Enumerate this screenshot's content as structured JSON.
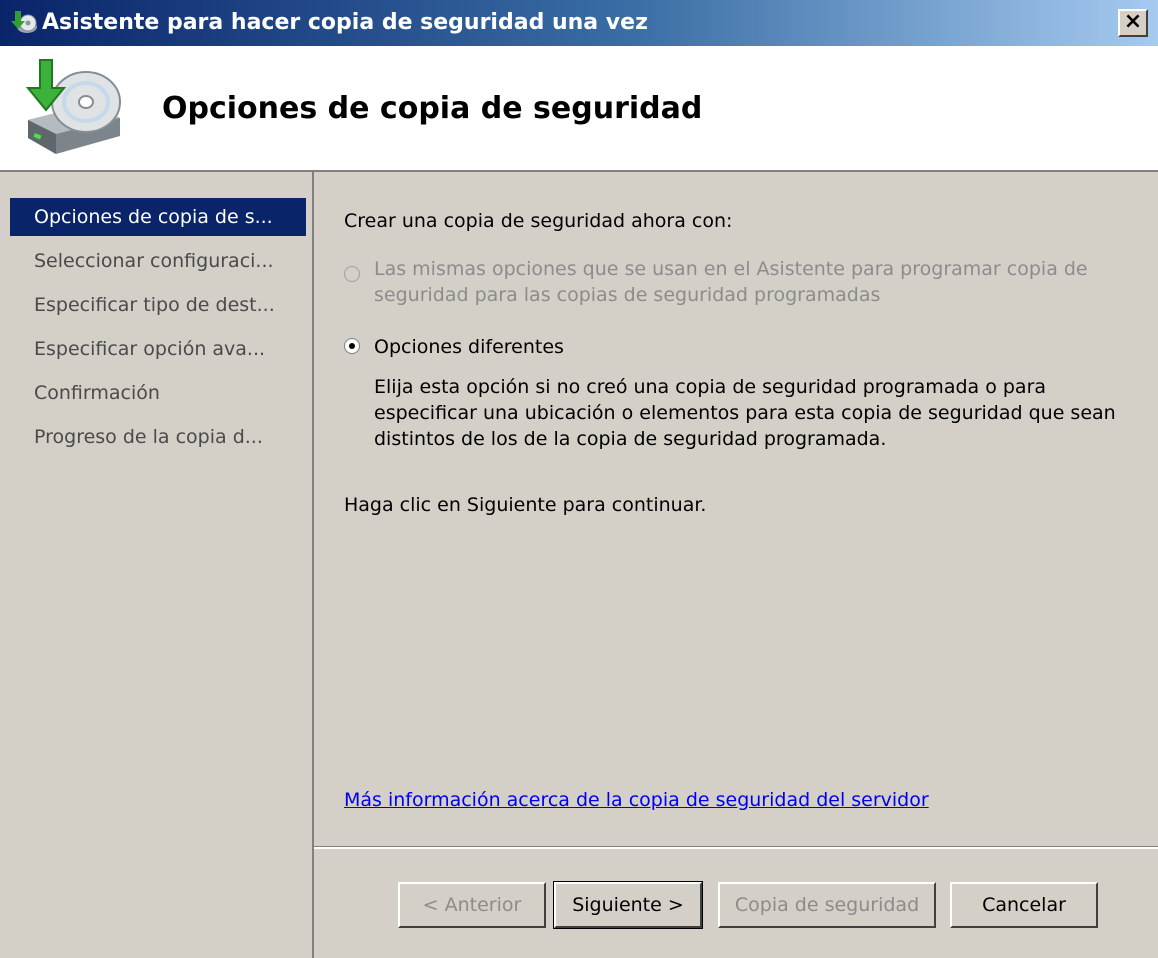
{
  "window": {
    "title": "Asistente para hacer copia de seguridad una vez",
    "close_label": "×"
  },
  "header": {
    "title": "Opciones de copia de seguridad"
  },
  "sidebar": {
    "items": [
      {
        "label": "Opciones de copia de s...",
        "active": true
      },
      {
        "label": "Seleccionar configuraci...",
        "active": false
      },
      {
        "label": "Especificar tipo de dest...",
        "active": false
      },
      {
        "label": "Especificar opción ava...",
        "active": false
      },
      {
        "label": "Confirmación",
        "active": false
      },
      {
        "label": "Progreso de la copia d...",
        "active": false
      }
    ]
  },
  "content": {
    "prompt": "Crear una copia de seguridad ahora con:",
    "options": [
      {
        "label": "Las mismas opciones que se usan en el Asistente para programar copia de seguridad para las copias de seguridad programadas",
        "selected": false,
        "enabled": false
      },
      {
        "label": "Opciones diferentes",
        "description": "Elija esta opción si no creó una copia de seguridad programada o para especificar una ubicación o elementos para esta copia de seguridad que sean distintos de los de la copia de seguridad programada.",
        "selected": true,
        "enabled": true
      }
    ],
    "continue_text": "Haga clic en Siguiente para continuar.",
    "more_info_link": "Más información acerca de la copia de seguridad del servidor"
  },
  "buttons": {
    "previous": "< Anterior",
    "next": "Siguiente >",
    "backup": "Copia de seguridad",
    "cancel": "Cancelar"
  },
  "colors": {
    "selection": "#0a246a",
    "dialog_face": "#d4d0c8",
    "link": "#0000ee",
    "disabled_text": "#8c8c8c"
  }
}
